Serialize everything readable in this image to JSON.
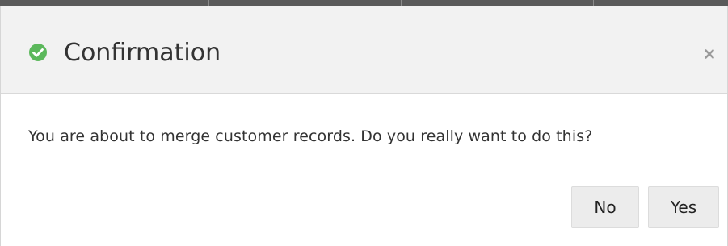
{
  "dialog": {
    "title": "Confirmation",
    "title_icon": "check-circle-icon",
    "close_icon": "close-icon",
    "message": "You are about to merge customer records. Do you really want to do this?",
    "buttons": {
      "no_label": "No",
      "yes_label": "Yes"
    }
  },
  "colors": {
    "success": "#5cb85c",
    "header_bg": "#f2f2f2",
    "button_bg": "#ececec"
  }
}
